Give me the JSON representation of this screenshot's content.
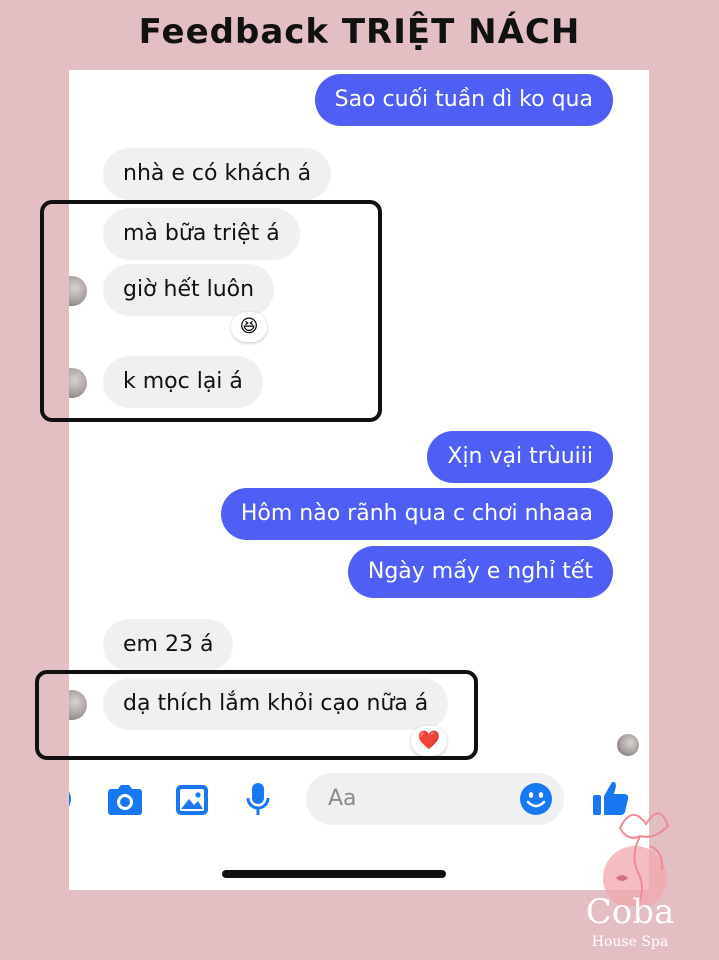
{
  "header": {
    "title": "Feedback TRIỆT NÁCH"
  },
  "messages": [
    {
      "dir": "out",
      "text": "Sao cuối tuần dì ko qua"
    },
    {
      "dir": "in",
      "text": "nhà e có khách á"
    },
    {
      "dir": "in",
      "text": "mà bữa triệt á"
    },
    {
      "dir": "in",
      "text": "giờ hết luôn",
      "reaction": "😆"
    },
    {
      "dir": "in",
      "text": "k mọc lại á"
    },
    {
      "dir": "out",
      "text": "Xịn vại trùuiii"
    },
    {
      "dir": "out",
      "text": "Hôm nào rãnh qua c chơi nhaaa"
    },
    {
      "dir": "out",
      "text": "Ngày mấy e nghỉ tết"
    },
    {
      "dir": "in",
      "text": "em 23 á"
    },
    {
      "dir": "in",
      "text": "dạ thích lắm khỏi cạo nữa á",
      "reaction": "❤️"
    }
  ],
  "composer": {
    "placeholder": "Aa",
    "icons": [
      "camera-icon",
      "image-icon",
      "microphone-icon",
      "emoji-icon",
      "thumbs-up-icon"
    ]
  },
  "colors": {
    "outgoing": "#4f5ef4",
    "incoming": "#f0f0f0",
    "icons": "#1877f2",
    "background": "#e3bfc4"
  },
  "logo": {
    "name": "Coba",
    "subtitle": "House Spa"
  }
}
